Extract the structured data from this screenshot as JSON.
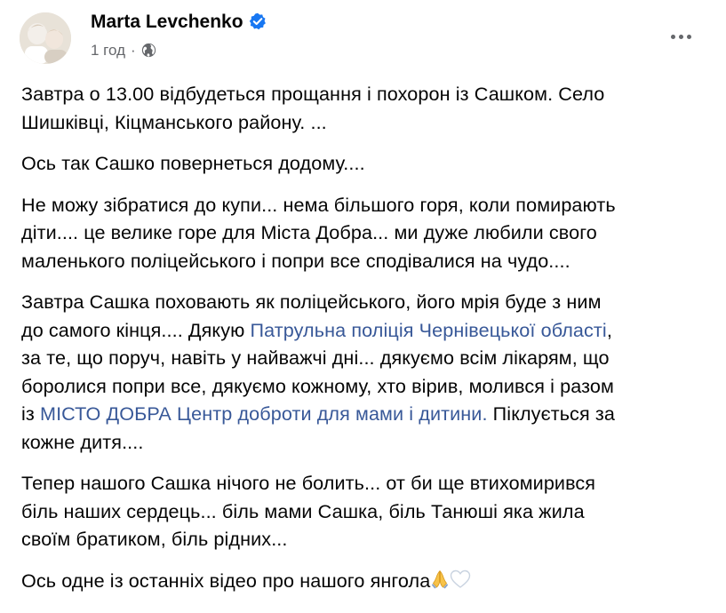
{
  "author": {
    "name": "Marta Levchenko",
    "verified": true,
    "avatar_icon": "avatar-photo-icon"
  },
  "meta": {
    "time": "1 год",
    "separator": "·",
    "privacy_icon": "globe-icon"
  },
  "more_icon": "more-options-icon",
  "colors": {
    "text": "#050505",
    "secondary": "#65676b",
    "link": "#385898",
    "verified": "#1877f2"
  },
  "post": {
    "p1": {
      "l1": "Завтра о 13.00 відбудеться прощання і похорон із Сашком. Село",
      "l2": "Шишківці, Кіцманського району. ..."
    },
    "p2": {
      "l1": "Ось так Сашко повернеться додому...."
    },
    "p3": {
      "l1": "Не можу зібратися до купи... нема більшого горя, коли помирають",
      "l2": "діти.... це велике горе для Міста Добра... ми дуже любили свого",
      "l3": "маленького поліцейського і попри все сподівалися на чудо...."
    },
    "p4": {
      "l1": "Завтра Сашка поховають як поліцейського, його мрія буде з ним",
      "l2_before": "до самого кінця.... Дякую ",
      "l2_link": "Патрульна поліція Чернівецької області",
      "l2_after": ",",
      "l3": "за те, що поруч, навіть у найважчі дні... дякуємо всім лікарям, що",
      "l4": "боролися попри все, дякуємо кожному, хто вірив, молився і разом",
      "l5_before": "із ",
      "l5_link": "МІСТО ДОБРА Центр доброти для мами і дитини.",
      "l5_after": " Піклується за",
      "l6": "кожне дитя...."
    },
    "p5": {
      "l1": "Тепер нашого Сашка нічого не болить... от би ще втихомирився",
      "l2": "біль наших сердець... біль мами Сашка, біль Танюші яка жила",
      "l3": "своїм братиком, біль рідних..."
    },
    "p6": {
      "l1": "Ось одне із останніх відео про нашого янгола",
      "emoji": [
        "folded-hands-icon",
        "white-heart-icon"
      ]
    }
  }
}
